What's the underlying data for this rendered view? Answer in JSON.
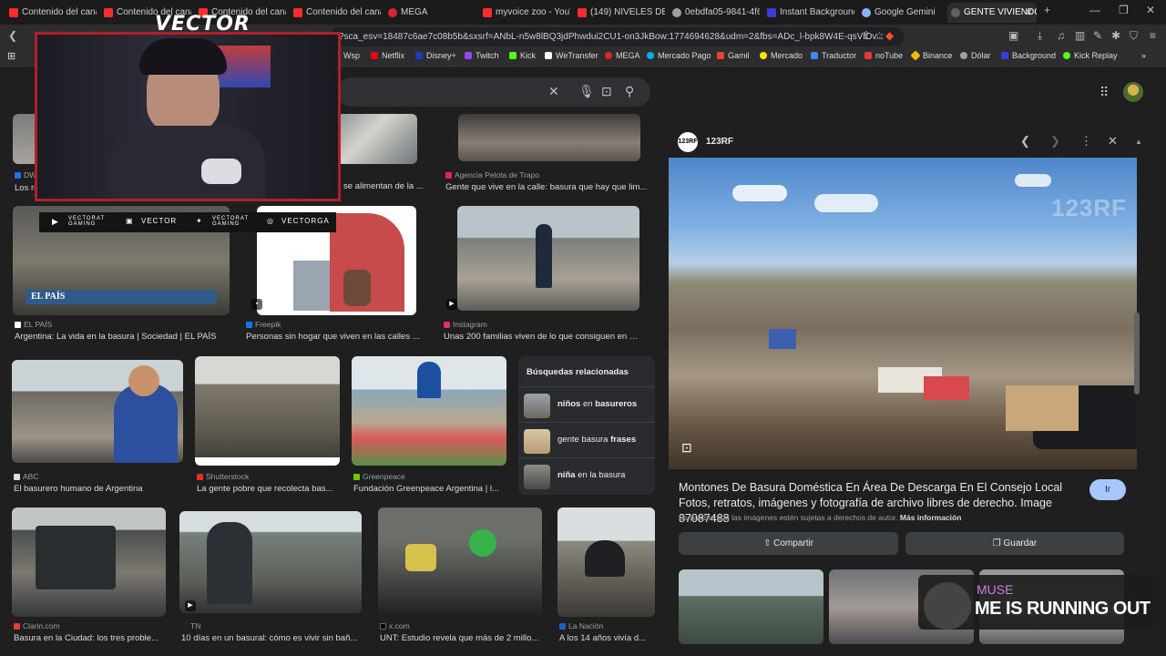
{
  "tabs": [
    {
      "label": "Contenido del canal",
      "color": "#ff2d2d"
    },
    {
      "label": "Contenido del canal",
      "color": "#ff2d2d"
    },
    {
      "label": "Contenido del canal",
      "color": "#ff2d2d"
    },
    {
      "label": "Contenido del canal",
      "color": "#ff2d2d"
    },
    {
      "label": "MEGA",
      "color": "#d9272e"
    },
    {
      "label": "myvoice zoo - YouT",
      "color": "#ff2d2d"
    },
    {
      "label": "(149) NIVELES DE P",
      "color": "#ff2d2d"
    },
    {
      "label": "0ebdfa05-9841-4f6",
      "color": "#9aa0a6"
    },
    {
      "label": "Instant Background",
      "color": "#3b3bd6"
    },
    {
      "label": "Google Gemini",
      "color": "#8ab4f8"
    },
    {
      "label": "GENTE VIVIENDO",
      "color": "#5f6368"
    }
  ],
  "url": "?sca_esv=18487c6ae7c08b5b&sxsrf=ANbL-n5w8lBQ3jdPhwdui2CU1-on3JkBow:1774694628&udm=2&fbs=ADc_l-bpk8W4E-qsVlOv...",
  "bookmarks": [
    {
      "label": "Wsp",
      "color": "#25d366"
    },
    {
      "label": "Netflix",
      "color": "#e50914"
    },
    {
      "label": "Disney+",
      "color": "#1f3cbf"
    },
    {
      "label": "Twitch",
      "color": "#9146ff"
    },
    {
      "label": "Kick",
      "color": "#53fc18"
    },
    {
      "label": "WeTransfer",
      "color": "#ffffff"
    },
    {
      "label": "MEGA",
      "color": "#d9272e"
    },
    {
      "label": "Mercado Pago",
      "color": "#00b1ea"
    },
    {
      "label": "Gamil",
      "color": "#ea4335"
    },
    {
      "label": "Mercado",
      "color": "#ffe600"
    },
    {
      "label": "Traductor",
      "color": "#4285f4"
    },
    {
      "label": "noTube",
      "color": "#e53935"
    },
    {
      "label": "Binance",
      "color": "#f0b90b"
    },
    {
      "label": "Dólar",
      "color": "#9aa0a6"
    },
    {
      "label": "Background",
      "color": "#3b3bd6"
    },
    {
      "label": "Kick Replay",
      "color": "#53fc18"
    }
  ],
  "results": [
    {
      "source": "DW",
      "title": "Los ri",
      "color": "#1a73e8"
    },
    {
      "source": "",
      "title": "se alimentan de la ...",
      "color": "#888"
    },
    {
      "source": "Agencia Pelota de Trapo",
      "title": "Gente que vive en la calle: basura que hay que lim...",
      "color": "#e91e63"
    },
    {
      "source": "EL PAÍS",
      "title": "Argentina: La vida en la basura | Sociedad | EL PAÍS",
      "color": "#fff",
      "label": "EL PAÍS"
    },
    {
      "source": "Freepik",
      "title": "Personas sin hogar que viven en las calles ...",
      "color": "#1273eb"
    },
    {
      "source": "Instagram",
      "title": "Unas 200 familias viven de lo que consiguen en un ...",
      "color": "#e1306c"
    },
    {
      "source": "ABC",
      "title": "El basurero humano de Argentina",
      "color": "#ddd"
    },
    {
      "source": "Shutterstock",
      "title": "La gente pobre que recolecta bas...",
      "color": "#ee2b24"
    },
    {
      "source": "Greenpeace",
      "title": "Fundación Greenpeace Argentina | l...",
      "color": "#66cc00"
    },
    {
      "source": "Clarin.com",
      "title": "Basura en la Ciudad: los tres proble...",
      "color": "#e53935"
    },
    {
      "source": "TN",
      "title": "10 días en un basural: cómo es vivir sin bañ...",
      "color": "#222"
    },
    {
      "source": "x.com",
      "title": "UNT: Estudio revela que más de 2 millo...",
      "color": "#000"
    },
    {
      "source": "La Nación",
      "title": "A los 14 años vivía d...",
      "color": "#1565c0"
    }
  ],
  "related": {
    "heading": "Búsquedas relacionadas",
    "items": [
      {
        "pre": "niños",
        "mid": " en ",
        "post": "basureros"
      },
      {
        "pre": "gente basura ",
        "mid": "",
        "post": "frases"
      },
      {
        "pre": "niña",
        "mid": " en la basura",
        "post": ""
      }
    ]
  },
  "panel": {
    "site": "123RF",
    "logo_text": "123RF",
    "title": "Montones De Basura Doméstica En Área De Descarga En El Consejo Local Fotos, retratos, imágenes y fotografía de archivo libres de derecho. Image 87087488",
    "visit": "Ir",
    "note": "Es posible que las imágenes estén sujetas a derechos de autor.",
    "more_info": "Más información",
    "share": "Compartir",
    "save": "Guardar",
    "watermark": "123RF"
  },
  "overlay": {
    "brand": "VECTOR",
    "socials": [
      "VECTORAT GAMING",
      "VECTOR",
      "VECTORAT GAMING",
      "VECTORGA"
    ],
    "music_artist": "MUSE",
    "music_song": "ME IS RUNNING OUT"
  }
}
